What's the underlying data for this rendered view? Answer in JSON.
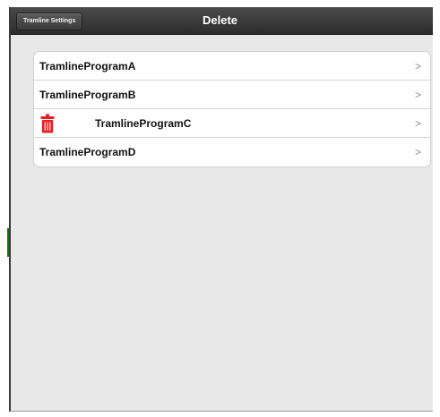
{
  "navbar": {
    "back_label": "Tramline Settings",
    "title": "Delete"
  },
  "programs": [
    {
      "label": "TramlineProgramA",
      "chevron": ">",
      "editing": false
    },
    {
      "label": "TramlineProgramB",
      "chevron": ">",
      "editing": false
    },
    {
      "label": "TramlineProgramC",
      "chevron": ">",
      "editing": true
    },
    {
      "label": "TramlineProgramD",
      "chevron": ">",
      "editing": false
    }
  ],
  "colors": {
    "delete_red": "#e52121",
    "navbar": "#3a3a3a",
    "background": "#e8e8e8"
  },
  "icons": {
    "delete": "trash-icon"
  }
}
